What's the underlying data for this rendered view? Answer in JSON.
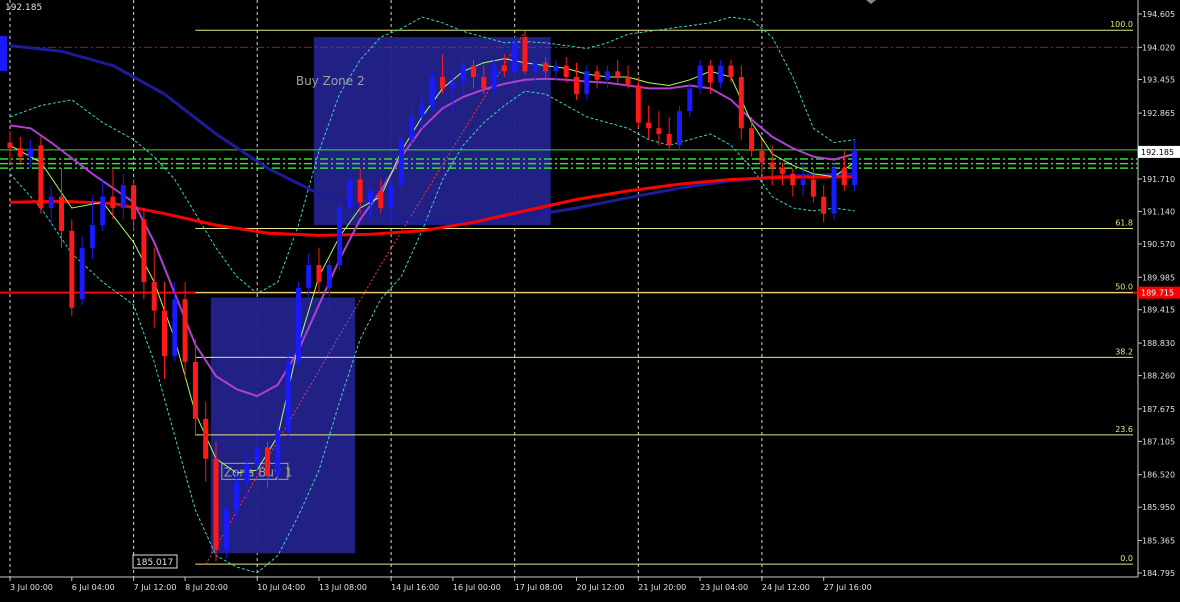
{
  "header": {
    "price_readout": "192.185"
  },
  "chart_data": {
    "type": "candlestick",
    "ylim": [
      184.795,
      194.605
    ],
    "y_ticks": [
      "194.605",
      "194.020",
      "193.455",
      "192.865",
      "192.185",
      "191.710",
      "191.140",
      "190.570",
      "189.985",
      "189.415",
      "188.830",
      "188.260",
      "187.675",
      "187.105",
      "186.520",
      "185.950",
      "185.365",
      "184.795"
    ],
    "y_tick_values": [
      194.605,
      194.02,
      193.455,
      192.865,
      192.185,
      191.71,
      191.14,
      190.57,
      189.985,
      189.415,
      188.83,
      188.26,
      187.675,
      187.105,
      186.52,
      185.95,
      185.365,
      184.795
    ],
    "x_ticks": [
      "3 Jul 00:00",
      "6 Jul 04:00",
      "7 Jul 12:00",
      "8 Jul 20:00",
      "10 Jul 04:00",
      "13 Jul 08:00",
      "14 Jul 16:00",
      "16 Jul 00:00",
      "17 Jul 08:00",
      "20 Jul 12:00",
      "21 Jul 20:00",
      "23 Jul 04:00",
      "24 Jul 12:00",
      "27 Jul 16:00"
    ],
    "x_tick_index": [
      0,
      6,
      12,
      17,
      24,
      30,
      37,
      43,
      49,
      55,
      61,
      67,
      73,
      79
    ],
    "n_bars": 83,
    "colors": {
      "bull": "#1a1aff",
      "bear": "#ff1a1a",
      "fib": "#e6e68a",
      "ma_red": "#ff0000",
      "ma_navy": "#1c1c9a",
      "ma_violet": "#b040d0",
      "ma_green": "#aaff66",
      "bands": "#40d0c0",
      "zone": "#23238c",
      "hline_green": "#33dd33",
      "hline_red": "#ff0000"
    },
    "fibonacci": [
      {
        "label": "100.0",
        "value": 194.32
      },
      {
        "label": "61.8",
        "value": 190.84
      },
      {
        "label": "50.0",
        "value": 189.715
      },
      {
        "label": "38.2",
        "value": 188.58
      },
      {
        "label": "23.6",
        "value": 187.22
      },
      {
        "label": "0.0",
        "value": 184.95
      }
    ],
    "current_price": {
      "label": "192.185",
      "value": 192.185
    },
    "red_price": {
      "label": "189.715",
      "value": 189.715
    },
    "low_label": "185.017",
    "zones": [
      {
        "label": "Buy Zone 2",
        "x0": 29.5,
        "x1": 52.5,
        "y0": 190.9,
        "y1": 194.2
      },
      {
        "label": "Zona Buy 1",
        "x0": 19.5,
        "x1": 33.5,
        "y0": 185.14,
        "y1": 189.63
      }
    ],
    "candles": [
      [
        192.35,
        192.55,
        192.0,
        192.25
      ],
      [
        192.25,
        192.45,
        191.95,
        192.1
      ],
      [
        192.1,
        192.4,
        191.9,
        192.25
      ],
      [
        192.3,
        192.45,
        191.1,
        191.2
      ],
      [
        191.2,
        191.6,
        190.9,
        191.4
      ],
      [
        191.4,
        191.9,
        190.5,
        190.8
      ],
      [
        190.8,
        191.0,
        189.3,
        189.45
      ],
      [
        189.6,
        190.7,
        189.5,
        190.5
      ],
      [
        190.5,
        191.4,
        190.3,
        190.9
      ],
      [
        190.9,
        191.7,
        190.8,
        191.4
      ],
      [
        191.4,
        191.9,
        191.0,
        191.2
      ],
      [
        191.2,
        191.8,
        191.0,
        191.6
      ],
      [
        191.6,
        191.7,
        190.8,
        191.0
      ],
      [
        191.0,
        191.2,
        189.6,
        189.9
      ],
      [
        189.9,
        190.5,
        189.1,
        189.4
      ],
      [
        189.4,
        189.9,
        188.2,
        188.6
      ],
      [
        188.6,
        189.9,
        188.5,
        189.6
      ],
      [
        189.6,
        189.9,
        188.2,
        188.5
      ],
      [
        188.5,
        188.9,
        187.2,
        187.5
      ],
      [
        187.5,
        187.8,
        186.4,
        186.8
      ],
      [
        186.8,
        187.1,
        185.0,
        185.2
      ],
      [
        185.2,
        186.0,
        185.05,
        185.9
      ],
      [
        185.9,
        186.6,
        185.7,
        186.4
      ],
      [
        186.4,
        186.9,
        186.1,
        186.7
      ],
      [
        186.7,
        187.2,
        186.5,
        187.0
      ],
      [
        187.0,
        187.1,
        186.3,
        186.5
      ],
      [
        186.5,
        187.5,
        186.4,
        187.3
      ],
      [
        187.3,
        188.7,
        187.2,
        188.5
      ],
      [
        188.5,
        189.9,
        188.4,
        189.8
      ],
      [
        189.8,
        190.4,
        189.6,
        190.2
      ],
      [
        190.2,
        190.5,
        189.7,
        189.9
      ],
      [
        189.8,
        190.3,
        189.4,
        190.2
      ],
      [
        190.2,
        191.3,
        190.1,
        191.2
      ],
      [
        191.2,
        191.9,
        191.0,
        191.7
      ],
      [
        191.7,
        191.9,
        191.1,
        191.3
      ],
      [
        191.3,
        191.6,
        191.0,
        191.5
      ],
      [
        191.5,
        191.7,
        191.1,
        191.2
      ],
      [
        191.2,
        191.7,
        190.9,
        191.6
      ],
      [
        191.6,
        192.5,
        191.5,
        192.4
      ],
      [
        192.4,
        193.0,
        192.3,
        192.8
      ],
      [
        192.8,
        193.2,
        192.6,
        193.0
      ],
      [
        193.0,
        193.6,
        192.9,
        193.5
      ],
      [
        193.5,
        193.9,
        193.2,
        193.3
      ],
      [
        193.3,
        193.6,
        192.9,
        193.4
      ],
      [
        193.4,
        193.8,
        193.2,
        193.7
      ],
      [
        193.7,
        193.8,
        193.3,
        193.5
      ],
      [
        193.5,
        193.7,
        193.2,
        193.3
      ],
      [
        193.3,
        193.8,
        193.2,
        193.7
      ],
      [
        193.7,
        193.9,
        193.5,
        193.6
      ],
      [
        193.6,
        194.2,
        193.55,
        194.1
      ],
      [
        194.2,
        194.3,
        193.55,
        193.6
      ],
      [
        193.6,
        193.8,
        193.4,
        193.75
      ],
      [
        193.75,
        193.85,
        193.5,
        193.6
      ],
      [
        193.6,
        193.8,
        193.45,
        193.7
      ],
      [
        193.7,
        193.85,
        193.4,
        193.5
      ],
      [
        193.5,
        193.75,
        193.1,
        193.2
      ],
      [
        193.2,
        193.7,
        193.1,
        193.6
      ],
      [
        193.6,
        193.7,
        193.3,
        193.45
      ],
      [
        193.45,
        193.7,
        193.3,
        193.6
      ],
      [
        193.6,
        193.8,
        193.4,
        193.5
      ],
      [
        193.5,
        193.7,
        193.3,
        193.35
      ],
      [
        193.35,
        193.5,
        192.6,
        192.7
      ],
      [
        192.7,
        193.0,
        192.4,
        192.6
      ],
      [
        192.6,
        192.9,
        192.3,
        192.5
      ],
      [
        192.5,
        192.8,
        192.2,
        192.3
      ],
      [
        192.3,
        193.0,
        192.2,
        192.9
      ],
      [
        192.9,
        193.4,
        192.8,
        193.3
      ],
      [
        193.3,
        193.8,
        193.2,
        193.7
      ],
      [
        193.7,
        193.8,
        193.2,
        193.4
      ],
      [
        193.4,
        193.8,
        193.3,
        193.7
      ],
      [
        193.7,
        193.8,
        193.4,
        193.5
      ],
      [
        193.5,
        193.7,
        192.4,
        192.6
      ],
      [
        192.6,
        192.8,
        192.1,
        192.2
      ],
      [
        192.2,
        192.4,
        191.8,
        192.0
      ],
      [
        192.0,
        192.3,
        191.6,
        191.9
      ],
      [
        191.9,
        192.0,
        191.6,
        191.8
      ],
      [
        191.8,
        191.9,
        191.4,
        191.6
      ],
      [
        191.6,
        192.0,
        191.4,
        191.7
      ],
      [
        191.7,
        191.9,
        191.3,
        191.4
      ],
      [
        191.4,
        191.6,
        190.95,
        191.1
      ],
      [
        191.1,
        192.0,
        191.0,
        191.9
      ],
      [
        191.9,
        192.2,
        191.5,
        191.6
      ],
      [
        191.6,
        192.4,
        191.5,
        192.2
      ]
    ],
    "ma_slow_red": [
      [
        0,
        191.3
      ],
      [
        5,
        191.32
      ],
      [
        10,
        191.28
      ],
      [
        15,
        191.1
      ],
      [
        20,
        190.9
      ],
      [
        25,
        190.76
      ],
      [
        30,
        190.72
      ],
      [
        35,
        190.74
      ],
      [
        40,
        190.8
      ],
      [
        45,
        190.95
      ],
      [
        50,
        191.15
      ],
      [
        55,
        191.35
      ],
      [
        60,
        191.5
      ],
      [
        65,
        191.62
      ],
      [
        70,
        191.7
      ],
      [
        75,
        191.74
      ],
      [
        82,
        191.75
      ]
    ],
    "ma_slow_navy": [
      [
        0,
        194.05
      ],
      [
        5,
        193.95
      ],
      [
        10,
        193.7
      ],
      [
        15,
        193.2
      ],
      [
        20,
        192.5
      ],
      [
        25,
        191.9
      ],
      [
        30,
        191.45
      ],
      [
        35,
        191.15
      ],
      [
        40,
        190.95
      ],
      [
        45,
        190.96
      ],
      [
        50,
        191.05
      ],
      [
        55,
        191.2
      ],
      [
        60,
        191.38
      ],
      [
        65,
        191.55
      ],
      [
        70,
        191.68
      ],
      [
        75,
        191.76
      ],
      [
        82,
        191.8
      ]
    ],
    "ma_violet": [
      [
        0,
        192.65
      ],
      [
        2,
        192.6
      ],
      [
        4,
        192.35
      ],
      [
        8,
        191.8
      ],
      [
        12,
        191.3
      ],
      [
        14,
        190.6
      ],
      [
        16,
        189.7
      ],
      [
        18,
        188.8
      ],
      [
        20,
        188.25
      ],
      [
        22,
        188.02
      ],
      [
        24,
        187.9
      ],
      [
        26,
        188.1
      ],
      [
        28,
        188.7
      ],
      [
        30,
        189.5
      ],
      [
        32,
        190.3
      ],
      [
        34,
        191.0
      ],
      [
        36,
        191.5
      ],
      [
        38,
        192.1
      ],
      [
        40,
        192.6
      ],
      [
        42,
        192.95
      ],
      [
        44,
        193.15
      ],
      [
        46,
        193.28
      ],
      [
        48,
        193.38
      ],
      [
        50,
        193.45
      ],
      [
        52,
        193.47
      ],
      [
        54,
        193.45
      ],
      [
        56,
        193.42
      ],
      [
        58,
        193.4
      ],
      [
        60,
        193.35
      ],
      [
        62,
        193.3
      ],
      [
        64,
        193.3
      ],
      [
        66,
        193.35
      ],
      [
        68,
        193.3
      ],
      [
        70,
        193.1
      ],
      [
        72,
        192.75
      ],
      [
        74,
        192.45
      ],
      [
        76,
        192.25
      ],
      [
        78,
        192.1
      ],
      [
        80,
        192.05
      ],
      [
        82,
        192.15
      ]
    ],
    "ma_green": [
      [
        0,
        192.3
      ],
      [
        3,
        192.0
      ],
      [
        6,
        191.2
      ],
      [
        9,
        191.3
      ],
      [
        12,
        190.6
      ],
      [
        14,
        189.9
      ],
      [
        16,
        188.9
      ],
      [
        18,
        187.6
      ],
      [
        20,
        186.8
      ],
      [
        22,
        186.55
      ],
      [
        24,
        186.6
      ],
      [
        26,
        187.2
      ],
      [
        28,
        188.8
      ],
      [
        30,
        190.0
      ],
      [
        32,
        190.7
      ],
      [
        34,
        191.2
      ],
      [
        36,
        191.4
      ],
      [
        38,
        192.2
      ],
      [
        40,
        192.8
      ],
      [
        42,
        193.3
      ],
      [
        44,
        193.6
      ],
      [
        46,
        193.75
      ],
      [
        48,
        193.82
      ],
      [
        50,
        193.75
      ],
      [
        52,
        193.7
      ],
      [
        54,
        193.65
      ],
      [
        56,
        193.55
      ],
      [
        58,
        193.5
      ],
      [
        60,
        193.5
      ],
      [
        62,
        193.4
      ],
      [
        64,
        193.35
      ],
      [
        66,
        193.45
      ],
      [
        68,
        193.6
      ],
      [
        70,
        193.5
      ],
      [
        72,
        192.7
      ],
      [
        74,
        192.15
      ],
      [
        76,
        191.95
      ],
      [
        78,
        191.8
      ],
      [
        80,
        191.75
      ],
      [
        82,
        192.0
      ]
    ],
    "band_upper": [
      [
        0,
        192.8
      ],
      [
        3,
        193.0
      ],
      [
        6,
        193.1
      ],
      [
        9,
        192.7
      ],
      [
        12,
        192.4
      ],
      [
        14,
        192.1
      ],
      [
        16,
        191.7
      ],
      [
        18,
        191.1
      ],
      [
        20,
        190.5
      ],
      [
        22,
        190.0
      ],
      [
        24,
        189.7
      ],
      [
        26,
        189.9
      ],
      [
        28,
        190.9
      ],
      [
        30,
        192.2
      ],
      [
        32,
        193.2
      ],
      [
        34,
        193.8
      ],
      [
        36,
        194.2
      ],
      [
        38,
        194.35
      ],
      [
        40,
        194.55
      ],
      [
        42,
        194.45
      ],
      [
        44,
        194.3
      ],
      [
        46,
        194.2
      ],
      [
        48,
        194.1
      ],
      [
        50,
        194.12
      ],
      [
        52,
        194.1
      ],
      [
        54,
        194.05
      ],
      [
        56,
        194.0
      ],
      [
        58,
        194.1
      ],
      [
        60,
        194.25
      ],
      [
        62,
        194.3
      ],
      [
        64,
        194.35
      ],
      [
        66,
        194.4
      ],
      [
        68,
        194.45
      ],
      [
        70,
        194.55
      ],
      [
        72,
        194.5
      ],
      [
        74,
        194.2
      ],
      [
        76,
        193.5
      ],
      [
        78,
        192.6
      ],
      [
        80,
        192.35
      ],
      [
        82,
        192.4
      ]
    ],
    "band_lower": [
      [
        0,
        191.8
      ],
      [
        3,
        191.2
      ],
      [
        6,
        190.4
      ],
      [
        9,
        189.9
      ],
      [
        12,
        189.5
      ],
      [
        14,
        188.5
      ],
      [
        16,
        187.2
      ],
      [
        18,
        185.9
      ],
      [
        20,
        185.1
      ],
      [
        22,
        184.9
      ],
      [
        24,
        184.8
      ],
      [
        26,
        185.1
      ],
      [
        28,
        185.8
      ],
      [
        30,
        186.6
      ],
      [
        32,
        187.8
      ],
      [
        34,
        188.9
      ],
      [
        36,
        189.6
      ],
      [
        38,
        190.0
      ],
      [
        40,
        190.8
      ],
      [
        42,
        191.7
      ],
      [
        44,
        192.3
      ],
      [
        46,
        192.7
      ],
      [
        48,
        193.0
      ],
      [
        50,
        193.25
      ],
      [
        52,
        193.2
      ],
      [
        54,
        193.0
      ],
      [
        56,
        192.8
      ],
      [
        58,
        192.7
      ],
      [
        60,
        192.6
      ],
      [
        62,
        192.4
      ],
      [
        64,
        192.3
      ],
      [
        66,
        192.4
      ],
      [
        68,
        192.5
      ],
      [
        70,
        192.3
      ],
      [
        72,
        191.9
      ],
      [
        74,
        191.4
      ],
      [
        76,
        191.2
      ],
      [
        78,
        191.15
      ],
      [
        80,
        191.2
      ],
      [
        82,
        191.15
      ]
    ],
    "trend_red_dotted": [
      [
        19,
        184.95
      ],
      [
        36,
        190.2
      ],
      [
        50,
        194.3
      ]
    ],
    "green_hlines": [
      192.22,
      192.06,
      191.98,
      191.9
    ]
  }
}
